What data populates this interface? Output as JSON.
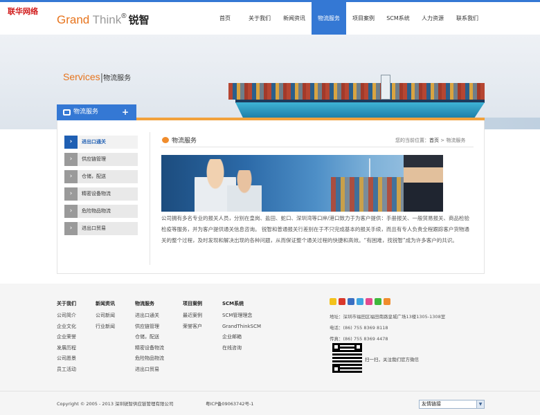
{
  "header": {
    "watermark": "联华网络",
    "logo_grand": "Grand",
    "logo_think": " Think",
    "logo_reg": "®",
    "logo_cn": "锐智",
    "nav": [
      {
        "label": "首页"
      },
      {
        "label": "关于我们"
      },
      {
        "label": "新闻资讯"
      },
      {
        "label": "物流服务",
        "active": true
      },
      {
        "label": "项目案例"
      },
      {
        "label": "SCM系统"
      },
      {
        "label": "人力资源"
      },
      {
        "label": "联系我们"
      }
    ]
  },
  "banner": {
    "title_en": "Services",
    "title_sep": "|",
    "title_cn": "物流服务"
  },
  "sidebar": {
    "heading": "物流服务",
    "plus": "+",
    "items": [
      {
        "label": "进出口通关",
        "active": true
      },
      {
        "label": "供应链管理"
      },
      {
        "label": "仓储，配送"
      },
      {
        "label": "精密设备物流"
      },
      {
        "label": "危险物品物流"
      },
      {
        "label": "进出口贸易"
      }
    ]
  },
  "content": {
    "title": "物流服务",
    "breadcrumb_prefix": "您的当前位置：",
    "breadcrumb_home": "首页",
    "breadcrumb_sep": " > ",
    "breadcrumb_current": "物流服务",
    "paragraph": "公司拥有多名专业的报关人员，分别在皇岗、盐田、蛇口、深圳湾等口岸/港口致力于为客户提供：手册报关、一般贸易报关、商品检验检疫等服务，并为客户提供通关信息咨询。 锐智和普通报关行差别在于不只完成基本的报关手续，而且有专人负责全程跟踪客户货物通关的整个过程，及时发现和解决出现的各种问题，从而保证整个通关过程的快捷和高效。“有困难，找锐智”成为许多客户的共识。"
  },
  "footer": {
    "columns": [
      {
        "heading": "关于我们",
        "links": [
          "公司简介",
          "企业文化",
          "企业荣誉",
          "发展历程",
          "公司愿景",
          "员工活动"
        ]
      },
      {
        "heading": "新闻资讯",
        "links": [
          "公司新闻",
          "行业新闻"
        ]
      },
      {
        "heading": "物流服务",
        "links": [
          "进出口通关",
          "供应链管理",
          "仓储，配送",
          "精密设备物流",
          "危险物品物流",
          "进出口贸易"
        ]
      },
      {
        "heading": "项目案例",
        "links": [
          "最近案例",
          "荣誉客户"
        ]
      },
      {
        "heading": "SCM系统",
        "links": [
          "SCM管理理念",
          "GrandThinkSCM",
          "企业邮箱",
          "在线咨询"
        ]
      }
    ],
    "address": "地址：深圳市福田区福田南路皇城广场13楼1305-1308室",
    "phone": "电话：(86) 755 8369 8118",
    "fax": "传真：(86) 755 8369 4478",
    "qr_text": "扫一扫，关注我们官方微信",
    "copyright": "Copyright © 2005 - 2013 深圳锐智供应链管理有限公司",
    "icp": "粤ICP备09063742号-1",
    "friend_links": "友情链接"
  },
  "colors": {
    "brand_blue": "#3478d4",
    "brand_orange": "#e7741d"
  }
}
